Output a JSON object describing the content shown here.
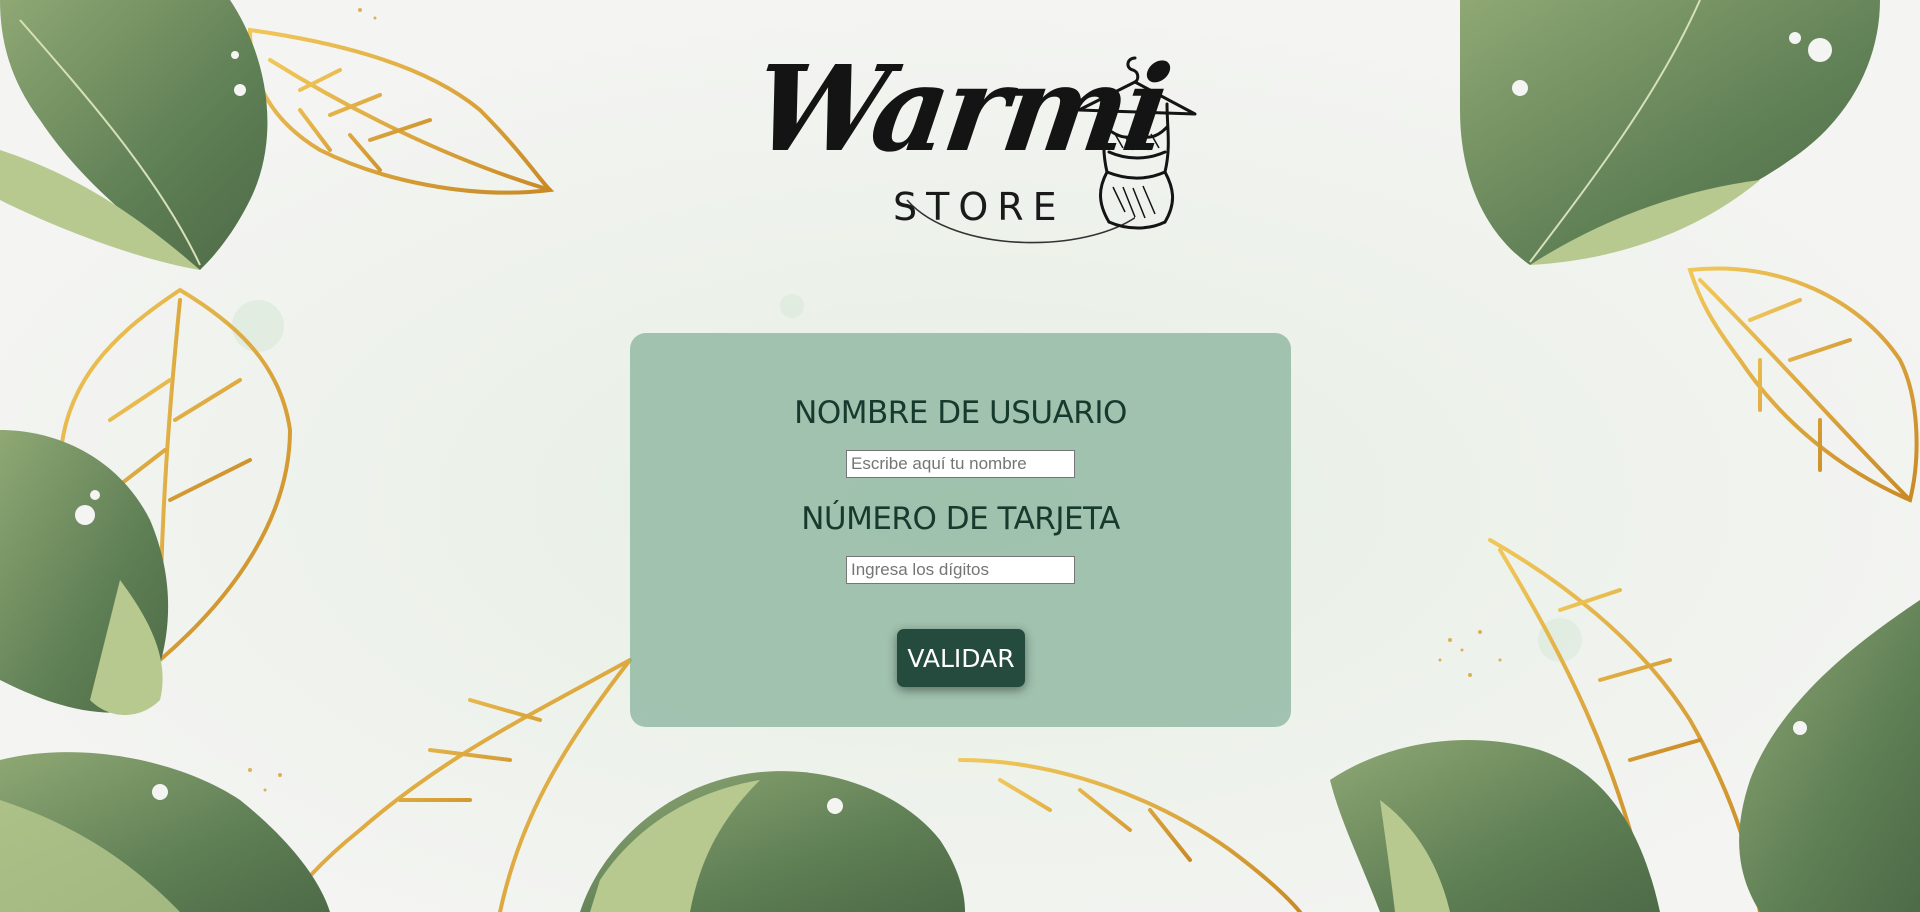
{
  "brand": {
    "name": "Warmi",
    "subtitle": "STORE"
  },
  "form": {
    "username_label": "NOMBRE DE USUARIO",
    "username_value": "",
    "username_placeholder": "Escribe aquí tu nombre",
    "card_label": "NÚMERO DE TARJETA",
    "card_value": "",
    "card_placeholder": "Ingresa los dígitos",
    "submit_label": "VALIDAR"
  },
  "colors": {
    "card_background": "#84b098",
    "label_text": "#163a2d",
    "button": "#244b3d",
    "leaf_green": "#6f8f5c",
    "leaf_light": "#b7c98f",
    "gold": "#d9a43a"
  },
  "decorations": {
    "leaf_icon": "monstera-leaf-icon",
    "gold_leaf_icon": "gold-leaf-outline-icon",
    "hanger_icon": "dress-on-hanger-icon"
  }
}
